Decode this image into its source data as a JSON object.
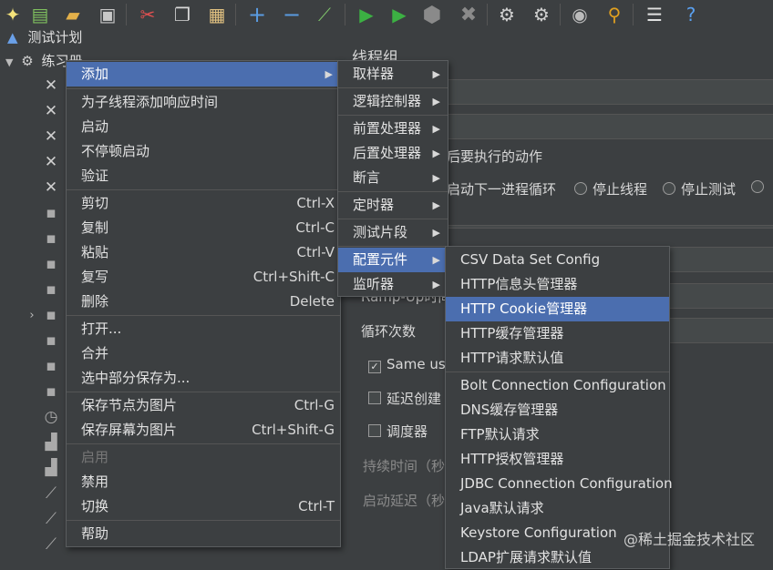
{
  "toolbar": {
    "icons": [
      "new-icon",
      "templates-icon",
      "open-icon",
      "save-icon",
      "cut-icon",
      "copy-icon",
      "paste-icon",
      "expand-icon",
      "collapse-icon",
      "toggle-icon",
      "start-icon",
      "start-no-pause-icon",
      "stop-icon",
      "shutdown-icon",
      "clear-icon",
      "clear-all-icon",
      "search-icon",
      "reset-search-icon",
      "function-helper-icon",
      "help-icon"
    ]
  },
  "tree": {
    "test_plan": "测试计划",
    "thread_group": "练习册"
  },
  "right_panel": {
    "title": "线程组",
    "after_error_label": "后要执行的动作",
    "opt_start_next": "启动下一进程循环",
    "opt_stop_thread": "停止线程",
    "opt_stop_test": "停止测试",
    "rampup_label": "Ramp-Up时间",
    "loop_label": "循环次数",
    "same_user": "Same use",
    "delay_create": "延迟创建",
    "scheduler": "调度器",
    "duration": "持续时间（秒",
    "startup_delay": "启动延迟（秒"
  },
  "context_menu": {
    "add": "添加",
    "add_think_time": "为子线程添加响应时间",
    "start": "启动",
    "start_no_pause": "不停顿启动",
    "validate": "验证",
    "cut": "剪切",
    "cut_sc": "Ctrl-X",
    "copy": "复制",
    "copy_sc": "Ctrl-C",
    "paste": "粘贴",
    "paste_sc": "Ctrl-V",
    "duplicate": "复写",
    "duplicate_sc": "Ctrl+Shift-C",
    "remove": "删除",
    "remove_sc": "Delete",
    "open": "打开...",
    "merge": "合并",
    "save_selection": "选中部分保存为...",
    "save_node_image": "保存节点为图片",
    "save_node_image_sc": "Ctrl-G",
    "save_screen_image": "保存屏幕为图片",
    "save_screen_image_sc": "Ctrl+Shift-G",
    "enable": "启用",
    "disable": "禁用",
    "toggle": "切换",
    "toggle_sc": "Ctrl-T",
    "help": "帮助"
  },
  "add_submenu": {
    "sampler": "取样器",
    "logic_controller": "逻辑控制器",
    "pre_processor": "前置处理器",
    "post_processor": "后置处理器",
    "assertion": "断言",
    "timer": "定时器",
    "test_fragment": "测试片段",
    "config_element": "配置元件",
    "listener": "监听器"
  },
  "config_submenu": {
    "items": [
      "CSV Data Set Config",
      "HTTP信息头管理器",
      "HTTP Cookie管理器",
      "HTTP缓存管理器",
      "HTTP请求默认值",
      "Bolt Connection Configuration",
      "DNS缓存管理器",
      "FTP默认请求",
      "HTTP授权管理器",
      "JDBC Connection Configuration",
      "Java默认请求",
      "Keystore Configuration",
      "LDAP扩展请求默认值"
    ],
    "selected": "HTTP Cookie管理器"
  },
  "watermark": "@稀土掘金技术社区",
  "colors": {
    "background": "#3c3f41",
    "selection": "#4b6eaf",
    "separator": "#555555"
  }
}
